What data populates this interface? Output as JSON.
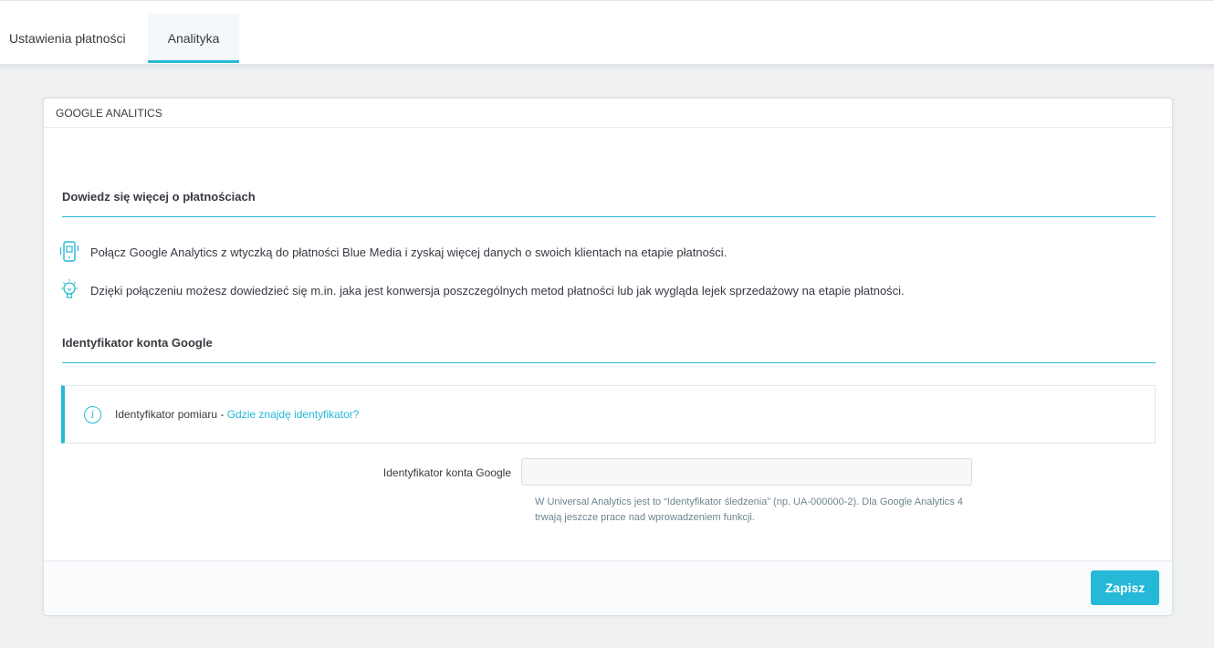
{
  "tabs": [
    {
      "label": "Ustawienia płatności",
      "active": false
    },
    {
      "label": "Analityka",
      "active": true
    }
  ],
  "card": {
    "header": "GOOGLE ANALITICS",
    "section1_title": "Dowiedz się więcej o płatnościach",
    "info_lines": [
      {
        "icon": "mobile-payment-icon",
        "text": "Połącz Google Analytics z wtyczką do płatności Blue Media i zyskaj więcej danych o swoich klientach na etapie płatności."
      },
      {
        "icon": "lightbulb-icon",
        "text": "Dzięki połączeniu możesz dowiedzieć się m.in. jaka jest konwersja poszczególnych metod płatności lub jak wygląda lejek sprzedażowy na etapie płatności."
      }
    ],
    "section2_title": "Identyfikator konta Google",
    "alert": {
      "icon": "info-icon",
      "text": "Identyfikator pomiaru - ",
      "link": "Gdzie znajdę identyfikator?"
    },
    "field": {
      "label": "Identyfikator konta Google",
      "value": "",
      "placeholder": "",
      "help": "W Universal Analytics jest to “Identyfikator śledzenia” (np. UA-000000-2). Dla Google Analytics 4 trwają jeszcze prace nad wprowadzeniem funkcji."
    },
    "save_label": "Zapisz"
  },
  "colors": {
    "accent": "#25b9d7",
    "background": "#eff1f2",
    "text": "#363a41"
  }
}
